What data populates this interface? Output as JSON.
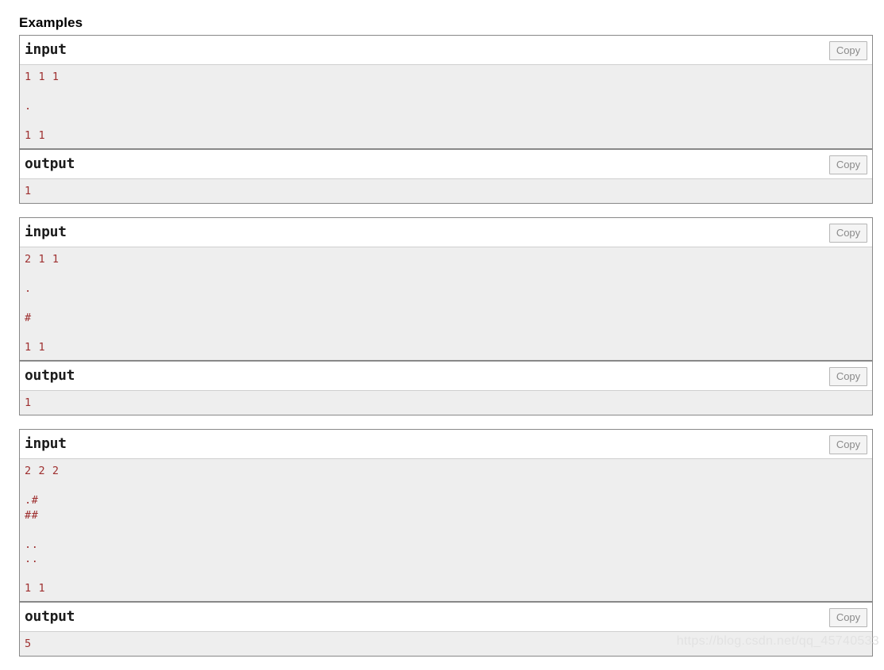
{
  "page": {
    "section_title": "Examples",
    "watermark": "https://blog.csdn.net/qq_45740533",
    "copy_label": "Copy",
    "input_label": "input",
    "output_label": "output",
    "accent_text_color": "#9e2f2f",
    "panel_border_color": "#888888",
    "code_background": "#eeeeee"
  },
  "examples": [
    {
      "input_title": "input",
      "input_copy": "Copy",
      "input_text": "1 1 1\n\n.\n\n1 1",
      "output_title": "output",
      "output_copy": "Copy",
      "output_text": "1"
    },
    {
      "input_title": "input",
      "input_copy": "Copy",
      "input_text": "2 1 1\n\n.\n\n#\n\n1 1",
      "output_title": "output",
      "output_copy": "Copy",
      "output_text": "1"
    },
    {
      "input_title": "input",
      "input_copy": "Copy",
      "input_text": "2 2 2\n\n.#\n##\n\n..\n..\n\n1 1",
      "output_title": "output",
      "output_copy": "Copy",
      "output_text": "5"
    }
  ]
}
